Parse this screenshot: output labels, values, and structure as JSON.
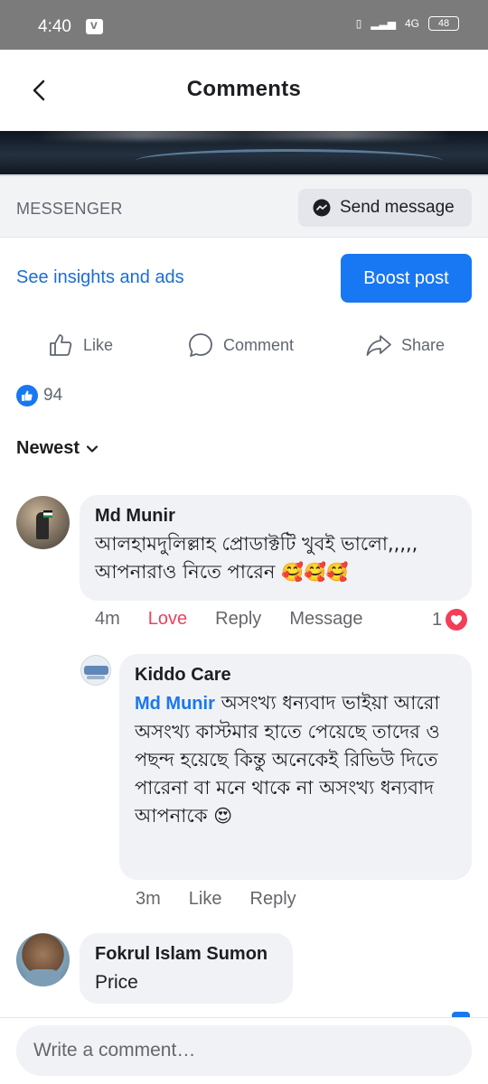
{
  "status_bar": {
    "time": "4:40",
    "network": "4G",
    "battery": "48"
  },
  "header": {
    "title": "Comments"
  },
  "messenger": {
    "label": "MESSENGER",
    "send_label": "Send message"
  },
  "post_actions": {
    "insights_label": "See insights and ads",
    "boost_label": "Boost post",
    "like_label": "Like",
    "comment_label": "Comment",
    "share_label": "Share",
    "reaction_count": "94"
  },
  "sort": {
    "label": "Newest"
  },
  "comments": [
    {
      "author": "Md Munir",
      "text": "আলহামদুলিল্লাহ প্রোডাক্টটি খুবই ভালো,,,,, আপনারাও নিতে পারেন",
      "emoji": "🥰🥰🥰",
      "time": "4m",
      "reaction_label": "Love",
      "reply_label": "Reply",
      "message_label": "Message",
      "love_count": "1"
    },
    {
      "author": "Kiddo Care",
      "mention": "Md Munir",
      "text": "অসংখ্য ধন্যবাদ ভাইয়া আরো অসংখ্য কাস্টমার হাতে পেয়েছে তাদের ও পছন্দ হয়েছে কিন্তু অনেকেই রিভিউ দিতে পারেনা বা মনে থাকে না অসংখ্য ধন্যবাদ আপনাকে",
      "emoji": "😍",
      "time": "3m",
      "like_label": "Like",
      "reply_label": "Reply"
    },
    {
      "author": "Fokrul Islam Sumon",
      "text": "Price"
    }
  ],
  "composer": {
    "placeholder": "Write a comment…"
  },
  "colors": {
    "accent": "#1877f2",
    "love": "#e9425d",
    "bubble": "#f0f2f5"
  }
}
